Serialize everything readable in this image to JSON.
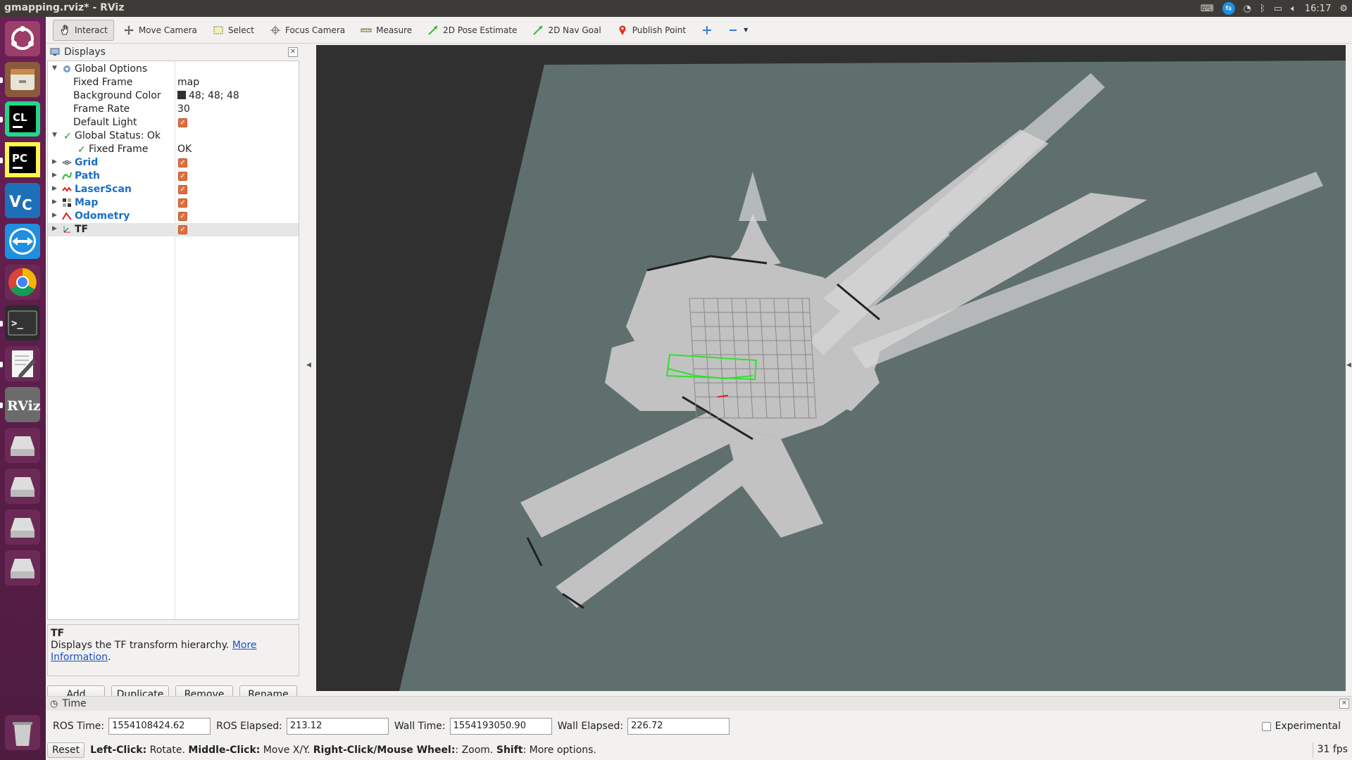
{
  "window_title": "gmapping.rviz* - RViz",
  "tray": {
    "time": "16:17"
  },
  "toolbar": {
    "tools": [
      {
        "label": "Interact",
        "icon": "hand-icon",
        "active": true
      },
      {
        "label": "Move Camera",
        "icon": "move-camera-icon"
      },
      {
        "label": "Select",
        "icon": "select-icon"
      },
      {
        "label": "Focus Camera",
        "icon": "focus-camera-icon"
      },
      {
        "label": "Measure",
        "icon": "measure-icon"
      },
      {
        "label": "2D Pose Estimate",
        "icon": "pose-estimate-icon"
      },
      {
        "label": "2D Nav Goal",
        "icon": "nav-goal-icon"
      },
      {
        "label": "Publish Point",
        "icon": "publish-point-icon"
      }
    ]
  },
  "displays": {
    "title": "Displays",
    "global_options": {
      "label": "Global Options",
      "fixed_frame_label": "Fixed Frame",
      "fixed_frame_value": "map",
      "background_color_label": "Background Color",
      "background_color_value": "48; 48; 48",
      "frame_rate_label": "Frame Rate",
      "frame_rate_value": "30",
      "default_light_label": "Default Light"
    },
    "global_status": {
      "label": "Global Status: Ok",
      "fixed_frame_label": "Fixed Frame",
      "fixed_frame_value": "OK"
    },
    "plugins": [
      {
        "label": "Grid",
        "enabled": true
      },
      {
        "label": "Path",
        "enabled": true
      },
      {
        "label": "LaserScan",
        "enabled": true
      },
      {
        "label": "Map",
        "enabled": true
      },
      {
        "label": "Odometry",
        "enabled": true
      },
      {
        "label": "TF",
        "enabled": true
      }
    ],
    "description": {
      "title": "TF",
      "text": "Displays the TF transform hierarchy.",
      "link": "More Information",
      "link_end": "."
    },
    "buttons": {
      "add": "Add",
      "duplicate": "Duplicate",
      "remove": "Remove",
      "rename": "Rename"
    }
  },
  "time": {
    "title": "Time",
    "ros_time_label": "ROS Time:",
    "ros_time_value": "1554108424.62",
    "ros_elapsed_label": "ROS Elapsed:",
    "ros_elapsed_value": "213.12",
    "wall_time_label": "Wall Time:",
    "wall_time_value": "1554193050.90",
    "wall_elapsed_label": "Wall Elapsed:",
    "wall_elapsed_value": "226.72",
    "experimental_label": "Experimental"
  },
  "status": {
    "reset": "Reset",
    "k1": "Left-Click:",
    "v1": " Rotate. ",
    "k2": "Middle-Click:",
    "v2": " Move X/Y. ",
    "k3": "Right-Click/Mouse Wheel:",
    "v3": ": Zoom. ",
    "k4": "Shift",
    "v4": ": More options.",
    "fps": "31 fps"
  },
  "colors": {
    "view_background": "#303030",
    "map_unknown": "#5f6f6e",
    "map_free": "#c0c0c0",
    "path": "#33dd33",
    "launcher": "#5d2047"
  }
}
